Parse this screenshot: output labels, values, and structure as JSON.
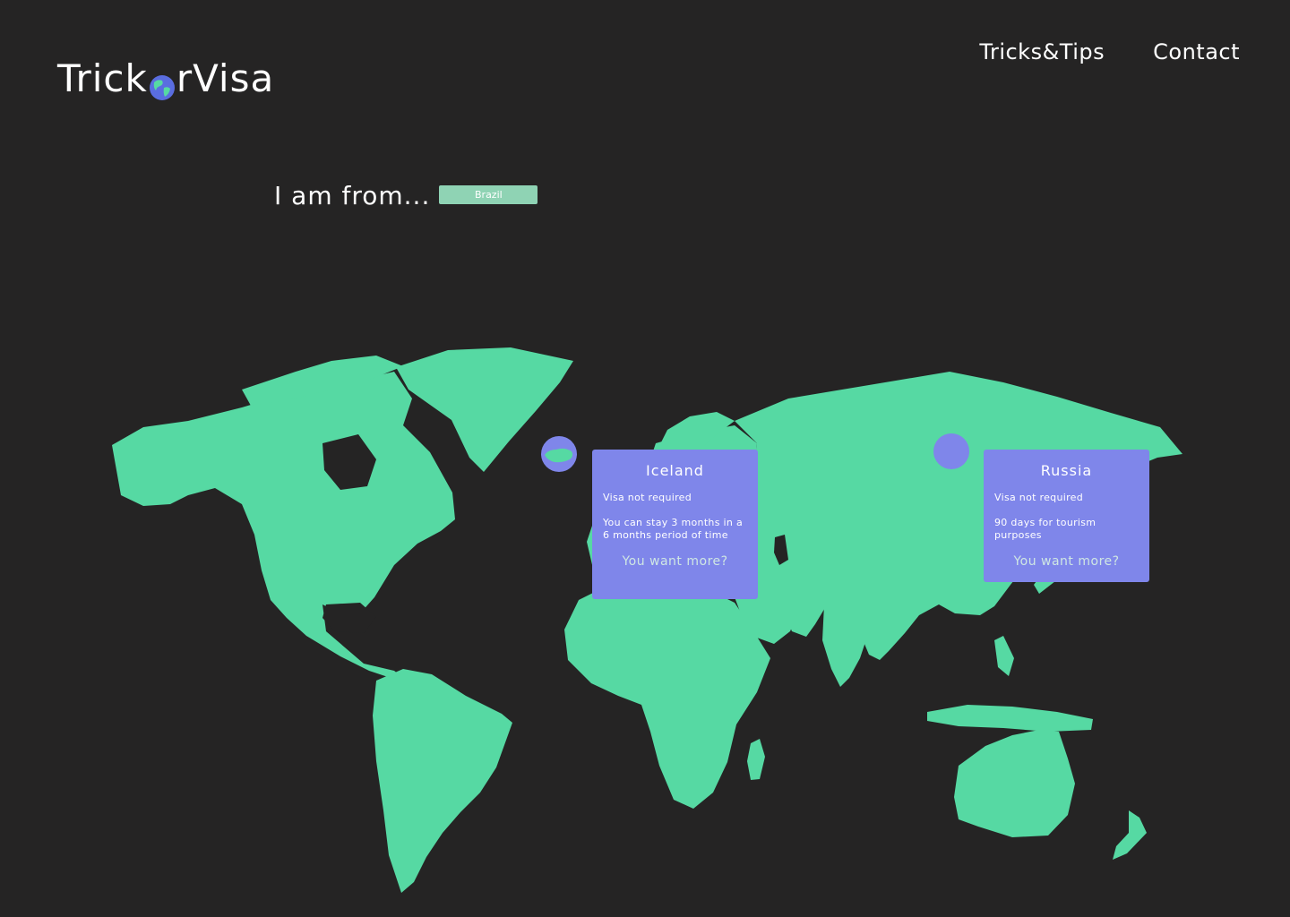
{
  "header": {
    "logo_left": "Trick",
    "logo_right": "rVisa",
    "nav": [
      "Tricks&Tips",
      "Contact"
    ]
  },
  "origin": {
    "label": "I am from...",
    "selected_country": "Brazil"
  },
  "map": {
    "land_color": "#56d9a3",
    "marker_color": "#7f86ea"
  },
  "cards": [
    {
      "country": "Iceland",
      "status": "Visa not required",
      "detail": "You can stay 3 months in a 6 months period of time",
      "more": "You want more?"
    },
    {
      "country": "Russia",
      "status": "Visa not required",
      "detail": "90 days for tourism purposes",
      "more": "You want more?"
    }
  ]
}
